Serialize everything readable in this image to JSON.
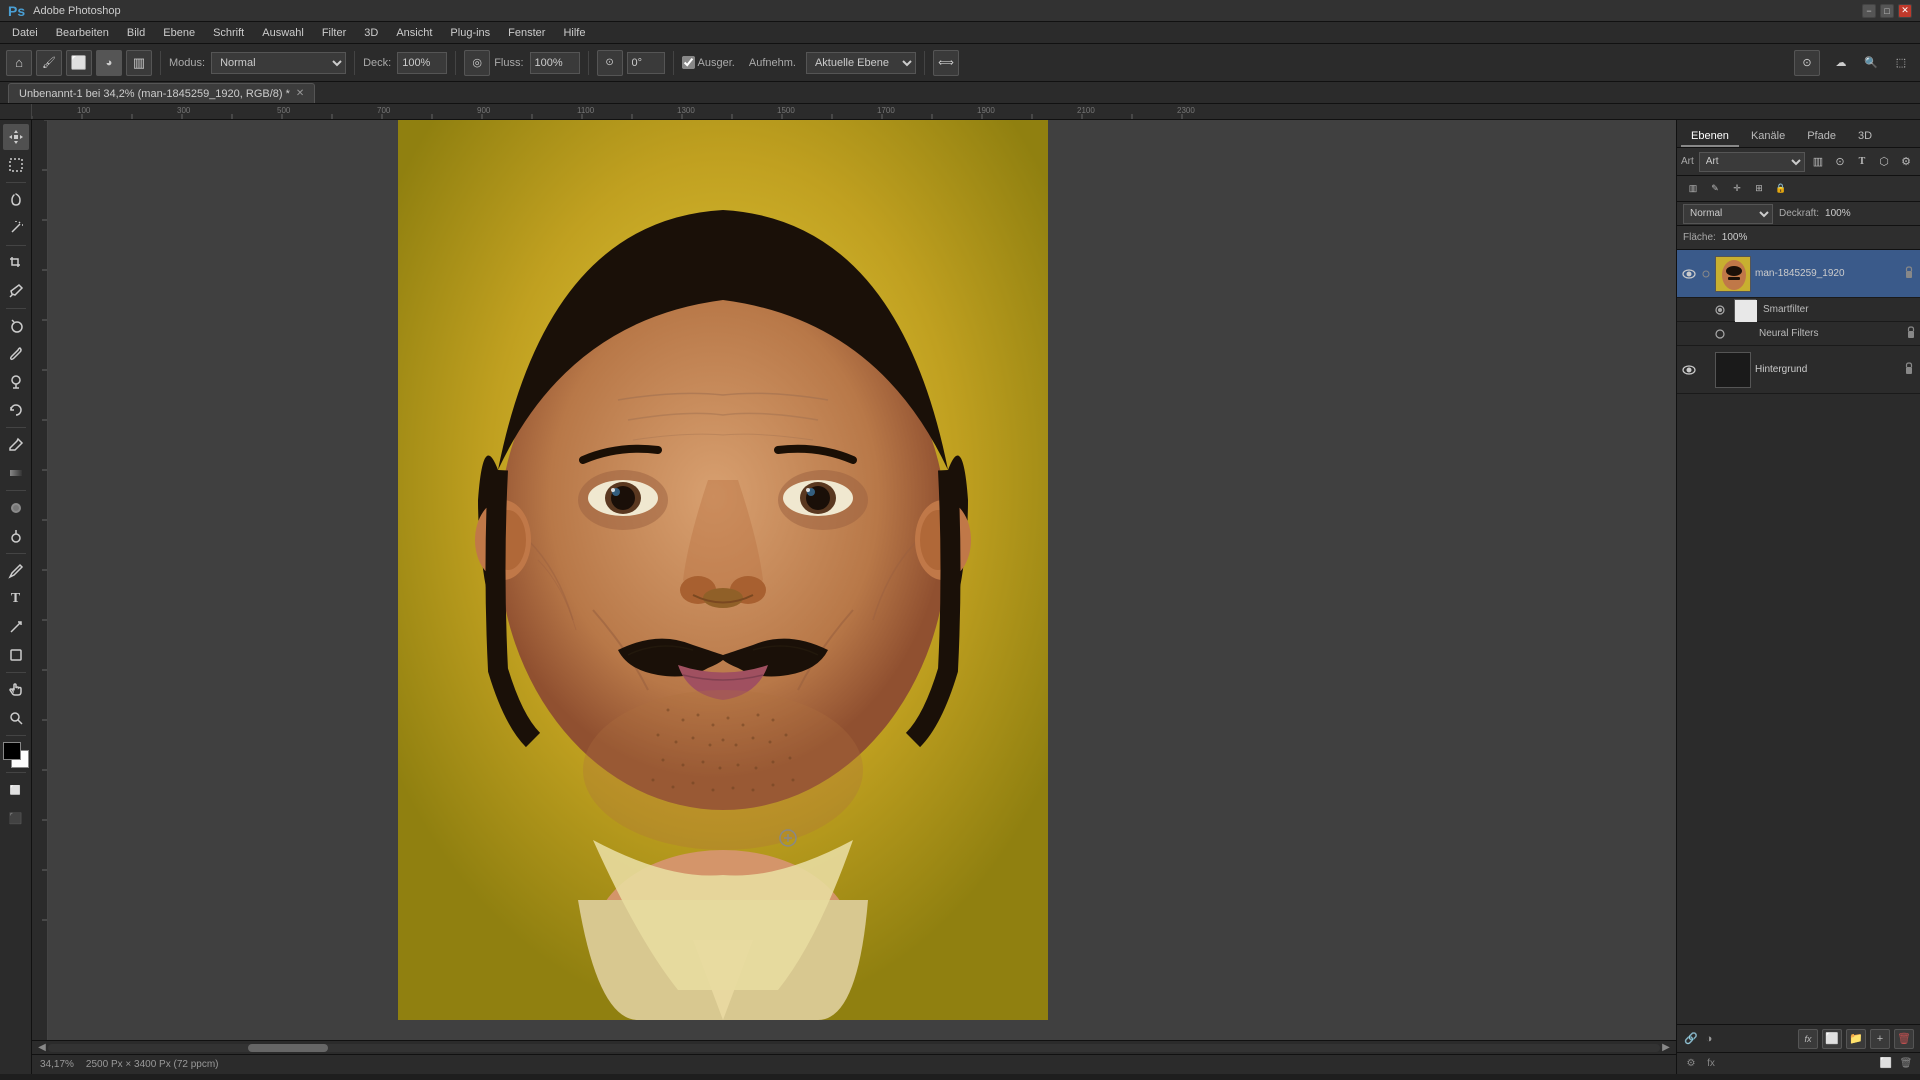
{
  "titleBar": {
    "title": "Adobe Photoshop",
    "minimize": "−",
    "maximize": "□",
    "close": "✕"
  },
  "menuBar": {
    "items": [
      "Datei",
      "Bearbeiten",
      "Bild",
      "Ebene",
      "Schrift",
      "Auswahl",
      "Filter",
      "3D",
      "Ansicht",
      "Plug-ins",
      "Fenster",
      "Hilfe"
    ]
  },
  "toolbar": {
    "homeIcon": "⌂",
    "modeLabel": "Modus:",
    "modeValue": "Normal",
    "deckLabel": "Deck:",
    "deckValue": "100%",
    "flussLabel": "Fluss:",
    "flussValue": "100%",
    "winkelValue": "0°",
    "ausg": "Ausger.",
    "aufnehm": "Aufnehm.",
    "aktEbene": "Aktuelle Ebene"
  },
  "tabBar": {
    "tab": "Unbenannt-1 bei 34,2% (man-1845259_1920, RGB/8) *",
    "closeTab": "✕"
  },
  "leftTools": {
    "tools": [
      {
        "name": "move-tool",
        "icon": "✛",
        "label": "Verschieben-Werkzeug"
      },
      {
        "name": "selection-tool",
        "icon": "⬚",
        "label": "Auswahlrahmen"
      },
      {
        "name": "lasso-tool",
        "icon": "⌀",
        "label": "Lasso"
      },
      {
        "name": "quick-select-tool",
        "icon": "⚡",
        "label": "Schnellauswahl"
      },
      {
        "name": "crop-tool",
        "icon": "⊡",
        "label": "Freistellen"
      },
      {
        "name": "eyedropper-tool",
        "icon": "✏",
        "label": "Pipette"
      },
      {
        "name": "spot-heal-tool",
        "icon": "⊕",
        "label": "Bereichsreparatur"
      },
      {
        "name": "brush-tool",
        "icon": "✎",
        "label": "Pinsel"
      },
      {
        "name": "stamp-tool",
        "icon": "⊞",
        "label": "Stempel"
      },
      {
        "name": "history-brush-tool",
        "icon": "↺",
        "label": "Protokollpinsel"
      },
      {
        "name": "eraser-tool",
        "icon": "◻",
        "label": "Radiergummi"
      },
      {
        "name": "gradient-tool",
        "icon": "▥",
        "label": "Verlauf"
      },
      {
        "name": "blur-tool",
        "icon": "◌",
        "label": "Weichzeichner"
      },
      {
        "name": "dodge-tool",
        "icon": "◯",
        "label": "Abwedler"
      },
      {
        "name": "pen-tool",
        "icon": "✒",
        "label": "Zeichenstift"
      },
      {
        "name": "text-tool",
        "icon": "T",
        "label": "Text"
      },
      {
        "name": "path-select-tool",
        "icon": "↗",
        "label": "Pfadauswahl"
      },
      {
        "name": "shape-tool",
        "icon": "⬡",
        "label": "Form"
      },
      {
        "name": "hand-tool",
        "icon": "✋",
        "label": "Hand"
      },
      {
        "name": "zoom-tool",
        "icon": "🔍",
        "label": "Zoom"
      }
    ]
  },
  "canvas": {
    "zoom": "34,17%",
    "size": "2500 Px × 3400 Px (72 ppcm)"
  },
  "rightPanel": {
    "tabs": [
      "Ebenen",
      "Kanäle",
      "Pfade",
      "3D"
    ],
    "activeTab": "Ebenen",
    "searchPlaceholder": "Art",
    "blendMode": "Normal",
    "opacityLabel": "Deckraft:",
    "opacityValue": "100%",
    "fillLabel": "Fläche:",
    "fillValue": "100%",
    "layers": [
      {
        "name": "man-1845259_1920",
        "type": "smart-object",
        "visible": true,
        "locked": true,
        "selected": true,
        "hasSubLayers": true,
        "sublayers": [
          "Smartfilter",
          "Neural Filters"
        ]
      },
      {
        "name": "Hintergrund",
        "type": "background",
        "visible": true,
        "locked": true,
        "selected": false
      }
    ],
    "lockIcons": [
      "🔒",
      "🔲",
      "🔄",
      "📌"
    ],
    "bottomButtons": [
      "fx",
      "⬜",
      "🗂",
      "🗄",
      "🗑"
    ]
  },
  "statusBar": {
    "zoom": "34,17%",
    "size": "2500 Px × 3400 Px (72 ppcm)"
  }
}
